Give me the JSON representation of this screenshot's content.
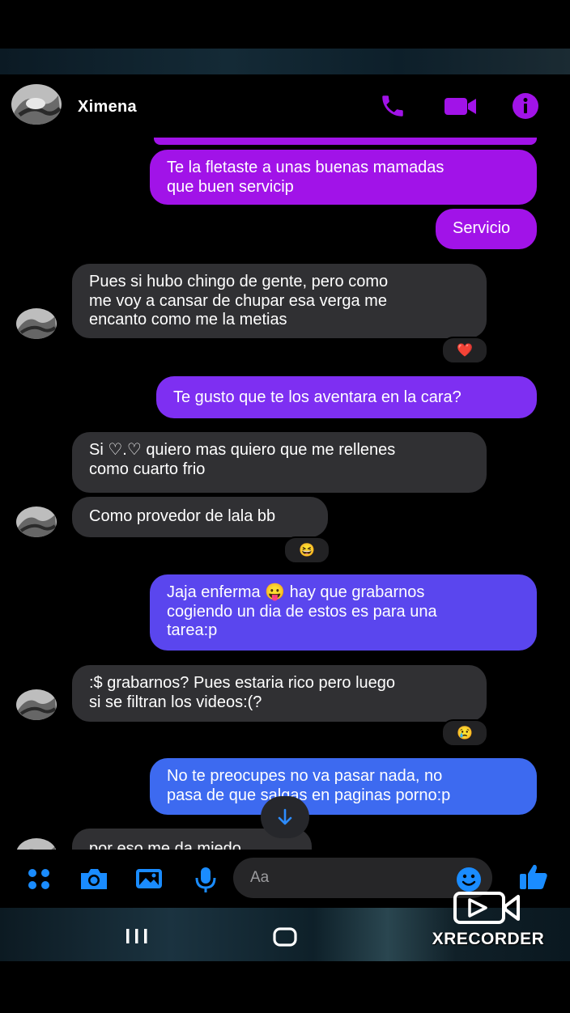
{
  "contact": {
    "name": "Ximena"
  },
  "header": {
    "call_icon": "phone-icon",
    "video_icon": "video-camera-icon",
    "info_icon": "info-icon"
  },
  "messages": [
    {
      "side": "out",
      "text": "Te la fletaste a unas buenas mamadas\nque buen servicip"
    },
    {
      "side": "out",
      "text": "Servicio"
    },
    {
      "side": "in",
      "text": "Pues si hubo chingo de gente, pero como\nme voy a cansar de chupar esa verga me\nencanto como me la metias",
      "reaction": "❤️"
    },
    {
      "side": "out",
      "text": "Te gusto que te los aventara en la cara?"
    },
    {
      "side": "in",
      "text": "Si ♡.♡ quiero mas quiero que me rellenes\ncomo cuarto frio"
    },
    {
      "side": "in",
      "text": "Como provedor de lala bb",
      "reaction": "😆"
    },
    {
      "side": "out",
      "text": "Jaja enferma 😛 hay que grabarnos\ncogiendo un dia de estos es para una\ntarea:p"
    },
    {
      "side": "in",
      "text": ":$ grabarnos? Pues estaria rico pero luego\nsi se filtran los videos:(?",
      "reaction": "😢"
    },
    {
      "side": "out",
      "text": "No te preocupes no va pasar nada, no\npasa de que salgas en paginas porno:p"
    },
    {
      "side": "in",
      "text": "por eso me da miedo"
    }
  ],
  "composer": {
    "placeholder": "Aa",
    "icons": [
      "apps-icon",
      "camera-icon",
      "gallery-icon",
      "microphone-icon",
      "emoji-icon",
      "thumbs-up-icon"
    ]
  },
  "watermark": {
    "text": "XRECORDER"
  },
  "colors": {
    "accent_purple": "#a113e8",
    "accent_blue": "#3d6af0",
    "incoming_bubble": "#303033",
    "composer_icon": "#1a8cff"
  }
}
